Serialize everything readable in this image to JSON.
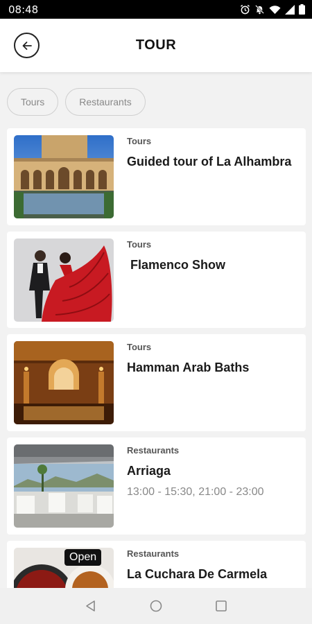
{
  "status": {
    "time": "08:48"
  },
  "header": {
    "title": "TOUR"
  },
  "filters": [
    "Tours",
    "Restaurants"
  ],
  "items": [
    {
      "category": "Tours",
      "title": "Guided tour of La Alhambra",
      "hours": ""
    },
    {
      "category": "Tours",
      "title": " Flamenco Show",
      "hours": ""
    },
    {
      "category": "Tours",
      "title": "Hamman Arab Baths",
      "hours": ""
    },
    {
      "category": "Restaurants",
      "title": "Arriaga",
      "hours": "13:00 - 15:30, 21:00 - 23:00"
    },
    {
      "category": "Restaurants",
      "title": "La Cuchara De Carmela",
      "hours": "",
      "badge": "Open"
    }
  ],
  "colors": {
    "status_bar": "#000000",
    "background": "#f2f2f2",
    "card": "#ffffff",
    "nav_bar": "#f0f0f0"
  }
}
